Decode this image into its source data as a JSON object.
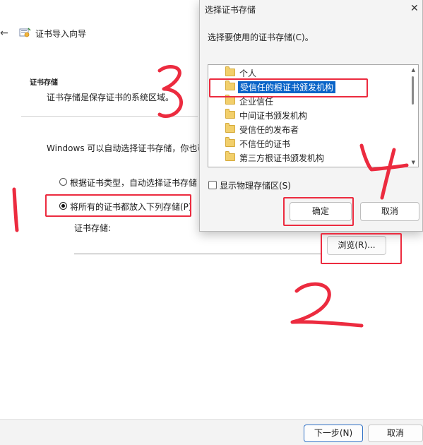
{
  "wizard": {
    "title": "证书导入向导",
    "section_title": "证书存储",
    "section_desc": "证书存储是保存证书的系统区域。",
    "info_text": "Windows 可以自动选择证书存储，你也可",
    "radio_auto_label": "根据证书类型，自动选择证书存储",
    "radio_manual_label": "将所有的证书都放入下列存储(P)",
    "radio_selected": "manual",
    "store_label": "证书存储:",
    "store_value": "",
    "browse_button": "浏览(R)...",
    "next_button": "下一步(N)",
    "cancel_button": "取消"
  },
  "dialog": {
    "title": "选择证书存储",
    "close_glyph": "✕",
    "prompt": "选择要使用的证书存储(C)。",
    "tree_items": [
      {
        "label": "个人",
        "selected": false
      },
      {
        "label": "受信任的根证书颁发机构",
        "selected": true
      },
      {
        "label": "企业信任",
        "selected": false
      },
      {
        "label": "中间证书颁发机构",
        "selected": false
      },
      {
        "label": "受信任的发布者",
        "selected": false
      },
      {
        "label": "不信任的证书",
        "selected": false
      },
      {
        "label": "第三方根证书颁发机构",
        "selected": false
      }
    ],
    "show_physical_label": "显示物理存储区(S)",
    "show_physical_checked": false,
    "ok_button": "确定",
    "cancel_button": "取消"
  },
  "annotations": {
    "color": "#ec2b3f",
    "steps": [
      "1",
      "2",
      "3",
      "4"
    ]
  },
  "icons": {
    "back": "back-arrow-icon",
    "wizard": "certificate-wizard-icon",
    "folder": "folder-icon",
    "close": "close-icon"
  }
}
